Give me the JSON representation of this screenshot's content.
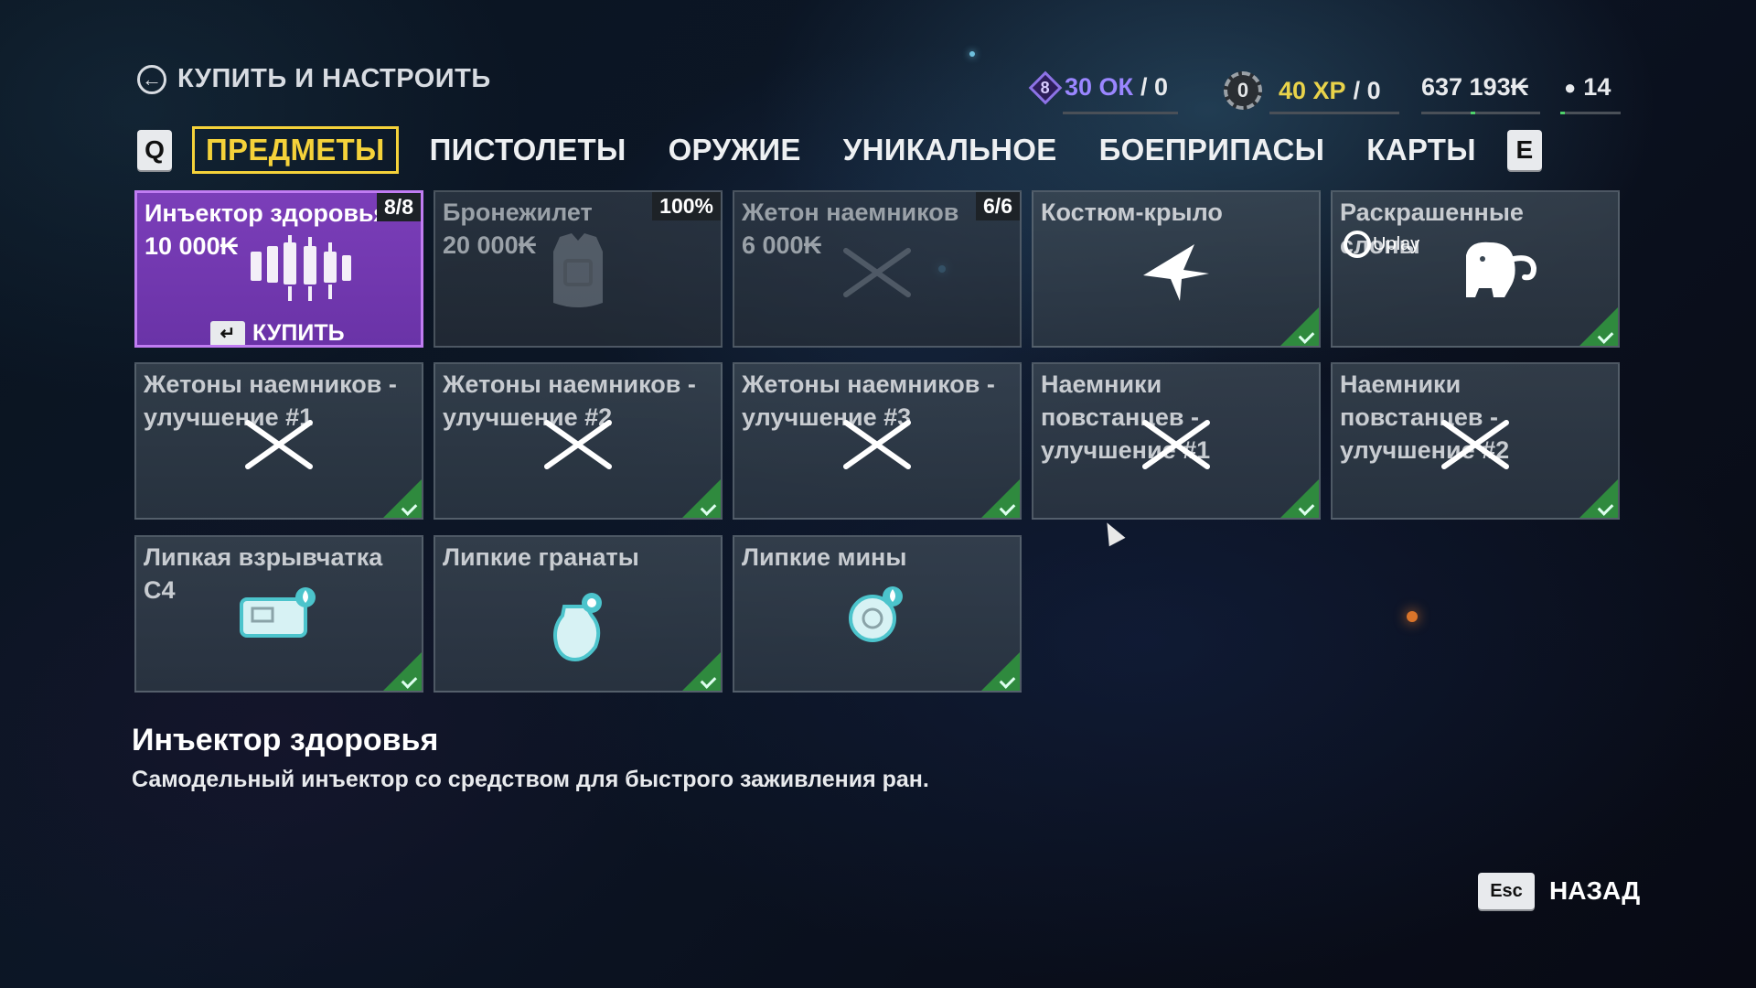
{
  "header": {
    "back_title": "КУПИТЬ И НАСТРОИТЬ",
    "stats": {
      "rank_level": "8",
      "ok_value": "30 ОК",
      "ok_suffix": "/ 0",
      "skill_level": "0",
      "xp_value": "40 XP",
      "xp_suffix": "/ 0",
      "money": "637 193₭",
      "bag_count": "14"
    }
  },
  "tabs": {
    "left_key": "Q",
    "right_key": "E",
    "items": [
      "ПРЕДМЕТЫ",
      "ПИСТОЛЕТЫ",
      "ОРУЖИЕ",
      "УНИКАЛЬНОЕ",
      "БОЕПРИПАСЫ",
      "КАРТЫ"
    ],
    "active": "ПРЕДМЕТЫ"
  },
  "tiles": [
    {
      "name": "Инъектор здоровья",
      "price": "10 000₭",
      "badge": "8/8",
      "state": "selected",
      "icon": "syringe-icon"
    },
    {
      "name": "Бронежилет",
      "price": "20 000₭",
      "badge": "100%",
      "state": "locked",
      "icon": "armor-vest-icon"
    },
    {
      "name": "Жетон наемников",
      "price": "6 000₭",
      "badge": "6/6",
      "state": "locked",
      "icon": "crossed-machetes-icon"
    },
    {
      "name": "Костюм-крыло",
      "state": "owned",
      "icon": "wingsuit-icon"
    },
    {
      "name": "Раскрашенные слоны",
      "state": "owned",
      "icon": "elephant-icon",
      "brand": "Uplay"
    },
    {
      "name": "Жетоны наемников - улучшение #1",
      "state": "owned",
      "icon": "crossed-machetes-icon"
    },
    {
      "name": "Жетоны наемников - улучшение #2",
      "state": "owned",
      "icon": "crossed-machetes-icon"
    },
    {
      "name": "Жетоны наемников - улучшение #3",
      "state": "owned",
      "icon": "crossed-machetes-icon"
    },
    {
      "name": "Наемники повстанцев - улучшение #1",
      "state": "owned",
      "icon": "crossed-machetes-icon"
    },
    {
      "name": "Наемники повстанцев - улучшение #2",
      "state": "owned",
      "icon": "crossed-machetes-icon"
    },
    {
      "name": "Липкая взрывчатка C4",
      "state": "owned",
      "icon": "c4-icon"
    },
    {
      "name": "Липкие гранаты",
      "state": "owned",
      "icon": "grenade-icon"
    },
    {
      "name": "Липкие мины",
      "state": "owned",
      "icon": "mine-icon"
    }
  ],
  "buy": {
    "key": "↵",
    "label": "КУПИТЬ"
  },
  "description": {
    "title": "Инъектор здоровья",
    "text": "Самодельный инъектор со средством для быстрого заживления ран."
  },
  "footer": {
    "esc_key": "Esc",
    "back_label": "НАЗАД"
  },
  "colors": {
    "active_tab": "#f5d23a",
    "selected_tile": "#6a33a7",
    "ok": "#9a86ff",
    "xp": "#e9d34a",
    "owned_check": "#2f8a3e"
  }
}
